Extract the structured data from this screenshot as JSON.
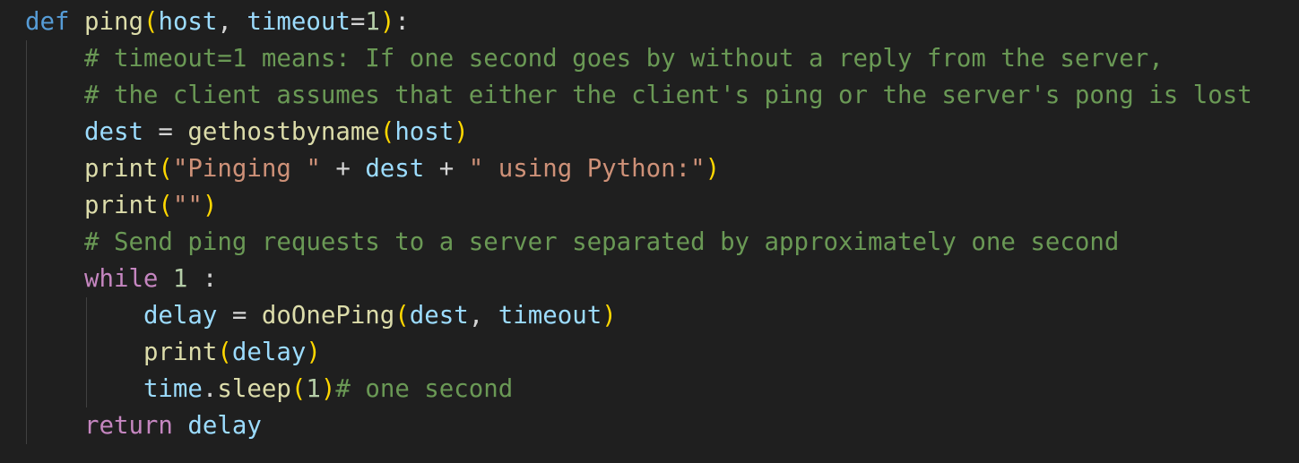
{
  "editor": {
    "language": "python",
    "colors": {
      "background": "#1f1f1f",
      "keyword": "#569cd6",
      "control_keyword": "#c586c0",
      "function": "#dcdcaa",
      "variable": "#9cdcfe",
      "number": "#b5cea8",
      "string": "#ce9178",
      "comment": "#6a9955",
      "default": "#d4d4d4",
      "bracket_level1": "#ffd700",
      "bracket_level2": "#da70d6"
    },
    "lines": [
      [
        [
          "def",
          "kw-def"
        ],
        [
          " ",
          "op"
        ],
        [
          "ping",
          "fn"
        ],
        [
          "(",
          "p1"
        ],
        [
          "host",
          "var"
        ],
        [
          ", ",
          "op"
        ],
        [
          "timeout",
          "var"
        ],
        [
          "=",
          "op"
        ],
        [
          "1",
          "num"
        ],
        [
          ")",
          "p1"
        ],
        [
          ":",
          "op"
        ]
      ],
      [
        [
          "    ",
          "op"
        ],
        [
          "# timeout=1 means: If one second goes by without a reply from the server,",
          "cmt"
        ]
      ],
      [
        [
          "    ",
          "op"
        ],
        [
          "# the client assumes that either the client's ping or the server's pong is lost",
          "cmt"
        ]
      ],
      [
        [
          "    ",
          "op"
        ],
        [
          "dest",
          "var"
        ],
        [
          " = ",
          "op"
        ],
        [
          "gethostbyname",
          "fn"
        ],
        [
          "(",
          "p1"
        ],
        [
          "host",
          "var"
        ],
        [
          ")",
          "p1"
        ]
      ],
      [
        [
          "    ",
          "op"
        ],
        [
          "print",
          "fn"
        ],
        [
          "(",
          "p1"
        ],
        [
          "\"Pinging \"",
          "str"
        ],
        [
          " + ",
          "op"
        ],
        [
          "dest",
          "var"
        ],
        [
          " + ",
          "op"
        ],
        [
          "\" using Python:\"",
          "str"
        ],
        [
          ")",
          "p1"
        ]
      ],
      [
        [
          "    ",
          "op"
        ],
        [
          "print",
          "fn"
        ],
        [
          "(",
          "p1"
        ],
        [
          "\"\"",
          "str"
        ],
        [
          ")",
          "p1"
        ]
      ],
      [
        [
          "    ",
          "op"
        ],
        [
          "# Send ping requests to a server separated by approximately one second",
          "cmt"
        ]
      ],
      [
        [
          "    ",
          "op"
        ],
        [
          "while",
          "kw-ctl"
        ],
        [
          " ",
          "op"
        ],
        [
          "1",
          "num"
        ],
        [
          " :",
          "op"
        ]
      ],
      [
        [
          "        ",
          "op"
        ],
        [
          "delay",
          "var"
        ],
        [
          " = ",
          "op"
        ],
        [
          "doOnePing",
          "fn"
        ],
        [
          "(",
          "p1"
        ],
        [
          "dest",
          "var"
        ],
        [
          ", ",
          "op"
        ],
        [
          "timeout",
          "var"
        ],
        [
          ")",
          "p1"
        ]
      ],
      [
        [
          "        ",
          "op"
        ],
        [
          "print",
          "fn"
        ],
        [
          "(",
          "p1"
        ],
        [
          "delay",
          "var"
        ],
        [
          ")",
          "p1"
        ]
      ],
      [
        [
          "        ",
          "op"
        ],
        [
          "time",
          "var"
        ],
        [
          ".",
          "op"
        ],
        [
          "sleep",
          "fn"
        ],
        [
          "(",
          "p1"
        ],
        [
          "1",
          "num"
        ],
        [
          ")",
          "p1"
        ],
        [
          "# one second",
          "cmt"
        ]
      ],
      [
        [
          "    ",
          "op"
        ],
        [
          "return",
          "kw-ctl"
        ],
        [
          " ",
          "op"
        ],
        [
          "delay",
          "var"
        ]
      ]
    ]
  }
}
